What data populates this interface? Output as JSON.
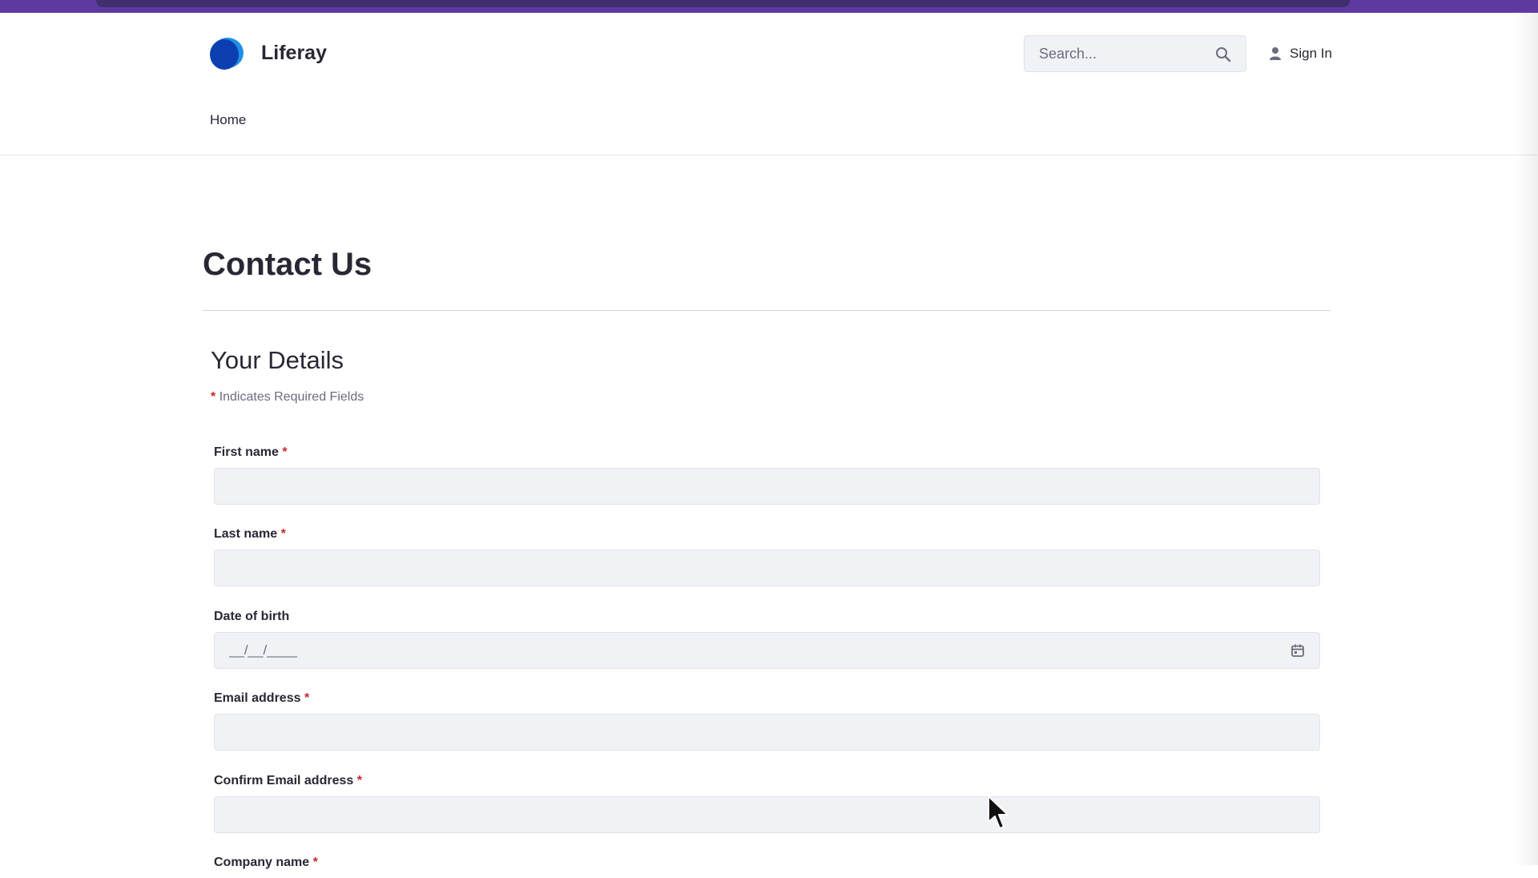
{
  "header": {
    "brand_name": "Liferay",
    "search_placeholder": "Search...",
    "sign_in_label": "Sign In",
    "nav": [
      {
        "label": "Home"
      }
    ]
  },
  "main": {
    "page_title": "Contact Us",
    "section_title": "Your Details",
    "required_marker": "*",
    "required_note": "Indicates Required Fields",
    "fields": [
      {
        "label": "First name",
        "required": "*",
        "value": ""
      },
      {
        "label": "Last name",
        "required": "*",
        "value": ""
      },
      {
        "label": "Date of birth",
        "placeholder": "__/__/____",
        "value": ""
      },
      {
        "label": "Email address",
        "required": "*",
        "value": ""
      },
      {
        "label": "Confirm Email address",
        "required": "*",
        "value": ""
      },
      {
        "label": "Company name",
        "required": "*",
        "value": ""
      }
    ]
  },
  "colors": {
    "accent_purple": "#5e3aa0",
    "logo_dark_blue": "#0b3fb0",
    "logo_light_blue": "#1f8fe6",
    "required_red": "#c62828",
    "input_bg": "#f1f2f5"
  },
  "icons": [
    "search-icon",
    "user-icon",
    "calendar-icon",
    "logo-icon"
  ]
}
